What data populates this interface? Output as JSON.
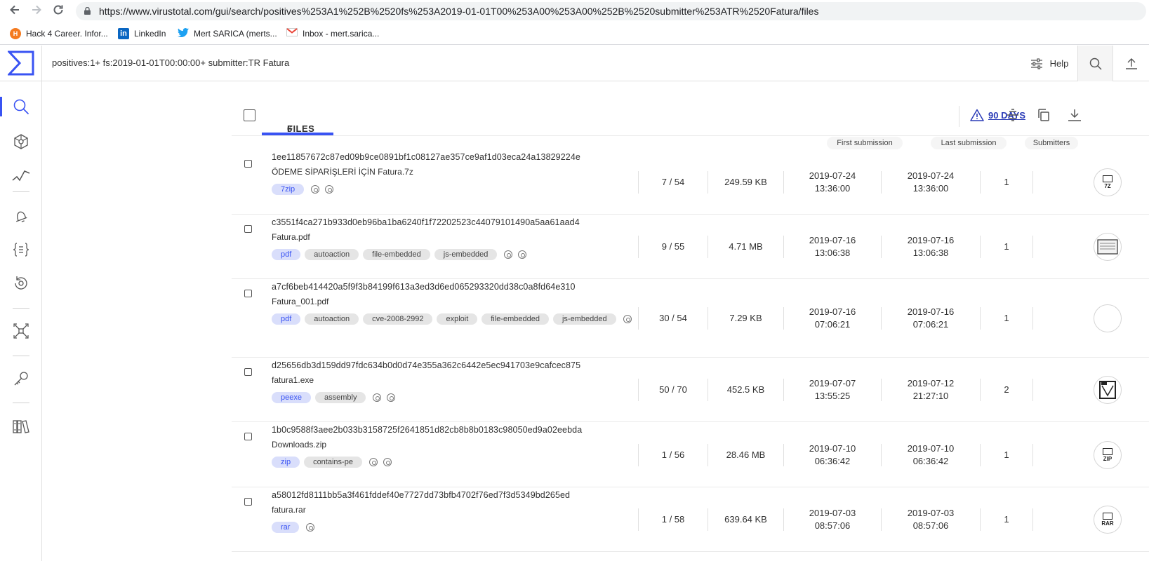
{
  "browser": {
    "url": "https://www.virustotal.com/gui/search/positives%253A1%252B%2520fs%253A2019-01-01T00%253A00%253A00%252B%2520submitter%253ATR%2520Fatura/files",
    "bookmarks": [
      {
        "label": "Hack 4 Career. Infor...",
        "icon": "hack4career-icon",
        "color": "#f47b20"
      },
      {
        "label": "LinkedIn",
        "icon": "linkedin-icon",
        "color": "#0a66c2"
      },
      {
        "label": "Mert SARICA (merts...",
        "icon": "twitter-icon",
        "color": "#1da1f2"
      },
      {
        "label": "Inbox - mert.sarica...",
        "icon": "gmail-icon",
        "color": "#ea4335"
      }
    ]
  },
  "header": {
    "query": "positives:1+ fs:2019-01-01T00:00:00+ submitter:TR Fatura",
    "help_label": "Help"
  },
  "files_header": {
    "tab_label": "FILES",
    "count": "6",
    "days_label": "90 DAYS"
  },
  "columns": {
    "first_submission": "First submission",
    "last_submission": "Last submission",
    "submitters": "Submitters"
  },
  "rows": [
    {
      "hash": "1ee11857672c87ed09b9ce0891bf1c08127ae357ce9af1d03eca24a13829224e",
      "name": "ÖDEME SİPARİŞLERİ İÇİN Fatura.7z",
      "tags": [
        {
          "label": "7zip",
          "filetype": true
        }
      ],
      "mini_icons": 2,
      "detections": "7 / 54",
      "size": "249.59 KB",
      "first_date": "2019-07-24",
      "first_time": "13:36:00",
      "last_date": "2019-07-24",
      "last_time": "13:36:00",
      "submitters": "1",
      "type_label": "7Z"
    },
    {
      "hash": "c3551f4ca271b933d0eb96ba1ba6240f1f72202523c44079101490a5aa61aad4",
      "name": "Fatura.pdf",
      "tags": [
        {
          "label": "pdf",
          "filetype": true
        },
        {
          "label": "autoaction"
        },
        {
          "label": "file-embedded"
        },
        {
          "label": "js-embedded"
        }
      ],
      "mini_icons": 2,
      "detections": "9 / 55",
      "size": "4.71 MB",
      "first_date": "2019-07-16",
      "first_time": "13:06:38",
      "last_date": "2019-07-16",
      "last_time": "13:06:38",
      "submitters": "1",
      "type_label": ""
    },
    {
      "hash": "a7cf6beb414420a5f9f3b84199f613a3ed3d6ed065293320dd38c0a8fd64e310",
      "name": "Fatura_001.pdf",
      "tags": [
        {
          "label": "pdf",
          "filetype": true
        },
        {
          "label": "autoaction"
        },
        {
          "label": "cve-2008-2992"
        },
        {
          "label": "exploit"
        },
        {
          "label": "file-embedded"
        },
        {
          "label": "js-embedded"
        }
      ],
      "mini_icons": 1,
      "detections": "30 / 54",
      "size": "7.29 KB",
      "first_date": "2019-07-16",
      "first_time": "07:06:21",
      "last_date": "2019-07-16",
      "last_time": "07:06:21",
      "submitters": "1",
      "type_label": ""
    },
    {
      "hash": "d25656db3d159dd97fdc634b0d0d74e355a362c6442e5ec941703e9cafcec875",
      "name": "fatura1.exe",
      "tags": [
        {
          "label": "peexe",
          "filetype": true
        },
        {
          "label": "assembly"
        }
      ],
      "mini_icons": 2,
      "detections": "50 / 70",
      "size": "452.5 KB",
      "first_date": "2019-07-07",
      "first_time": "13:55:25",
      "last_date": "2019-07-12",
      "last_time": "21:27:10",
      "submitters": "2",
      "type_label": ""
    },
    {
      "hash": "1b0c9588f3aee2b033b3158725f2641851d82cb8b8b0183c98050ed9a02eebda",
      "name": "Downloads.zip",
      "tags": [
        {
          "label": "zip",
          "filetype": true
        },
        {
          "label": "contains-pe"
        }
      ],
      "mini_icons": 2,
      "detections": "1 / 56",
      "size": "28.46 MB",
      "first_date": "2019-07-10",
      "first_time": "06:36:42",
      "last_date": "2019-07-10",
      "last_time": "06:36:42",
      "submitters": "1",
      "type_label": "ZIP"
    },
    {
      "hash": "a58012fd8111bb5a3f461fddef40e7727dd73bfb4702f76ed7f3d5349bd265ed",
      "name": "fatura.rar",
      "tags": [
        {
          "label": "rar",
          "filetype": true
        }
      ],
      "mini_icons": 1,
      "detections": "1 / 58",
      "size": "639.64 KB",
      "first_date": "2019-07-03",
      "first_time": "08:57:06",
      "last_date": "2019-07-03",
      "last_time": "08:57:06",
      "submitters": "1",
      "type_label": "RAR"
    }
  ],
  "colors": {
    "accent": "#3953f3",
    "tag_filetype_bg": "#d9defb",
    "tag_bg": "#e5e5e5",
    "link": "#2a3bb7"
  }
}
